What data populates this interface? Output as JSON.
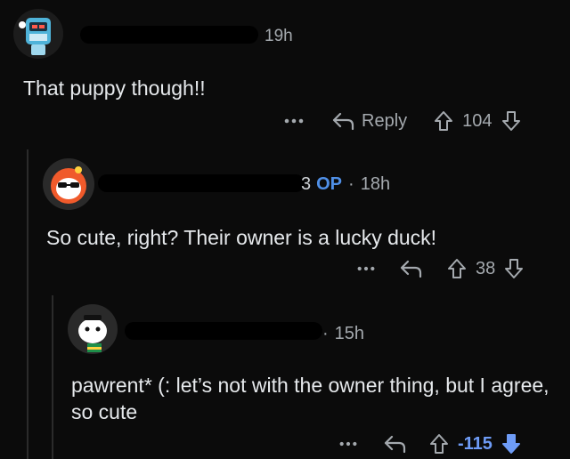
{
  "comments": [
    {
      "time": "19h",
      "body": "That puppy though!!",
      "reply_label": "Reply",
      "score": "104",
      "vote": "none"
    },
    {
      "username_fragment": "3",
      "op_badge": "OP",
      "dot": "·",
      "time": "18h",
      "body": "So cute, right? Their owner is a lucky duck!",
      "score": "38",
      "vote": "none"
    },
    {
      "dot": "·",
      "time": "15h",
      "body": "pawrent* (: let’s not with the owner thing, but I agree, so cute",
      "score": "-115",
      "vote": "down"
    }
  ],
  "icons": {
    "more": "more-dots-icon",
    "reply": "reply-arrow-icon",
    "upvote": "upvote-arrow-icon",
    "downvote": "downvote-arrow-icon"
  },
  "colors": {
    "background": "#0b0b0b",
    "op_badge": "#4f8fe6",
    "downvoted": "#6e9cf7",
    "meta": "#a4a9ae"
  }
}
